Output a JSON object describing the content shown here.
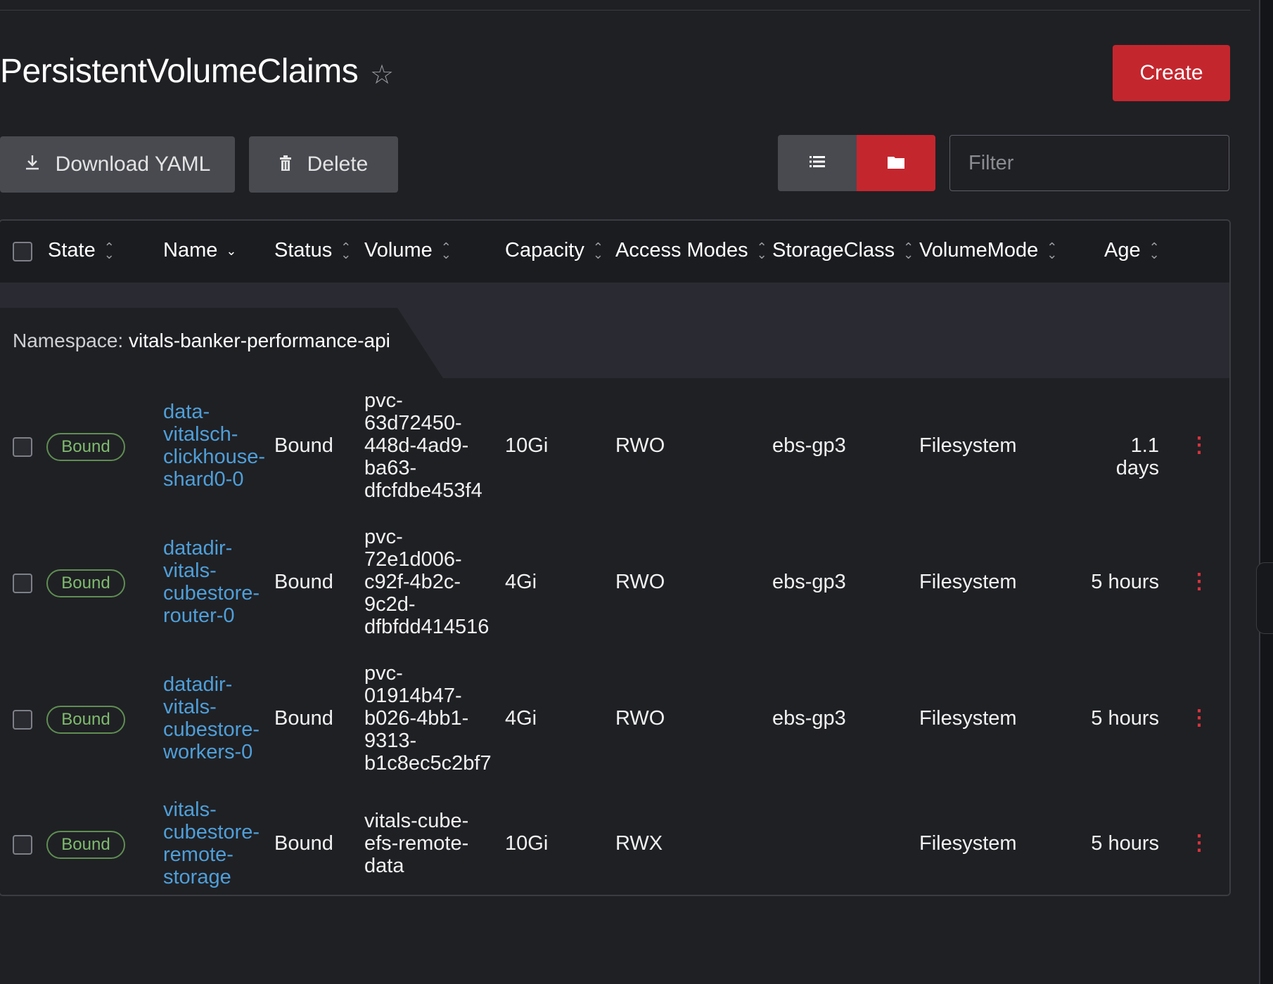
{
  "page": {
    "title": "PersistentVolumeClaims",
    "create_label": "Create",
    "download_label": "Download YAML",
    "delete_label": "Delete",
    "filter_placeholder": "Filter"
  },
  "colors": {
    "accent": "#c4262e",
    "link": "#4f9fd9",
    "badge": "#7fbb6e"
  },
  "table": {
    "columns": [
      "State",
      "Name",
      "Status",
      "Volume",
      "Capacity",
      "Access Modes",
      "StorageClass",
      "VolumeMode",
      "Age"
    ],
    "group": {
      "label": "Namespace:",
      "value": "vitals-banker-performance-api"
    },
    "rows": [
      {
        "state": "Bound",
        "name": [
          "data-",
          "vitalsch-",
          "clickhouse-",
          "shard0-0"
        ],
        "status": "Bound",
        "volume": [
          "pvc-",
          "63d72450-",
          "448d-4ad9-",
          "ba63-",
          "dfcfdbe453f4"
        ],
        "capacity": "10Gi",
        "access": "RWO",
        "storage_class": "ebs-gp3",
        "volume_mode": "Filesystem",
        "age": "1.1 days"
      },
      {
        "state": "Bound",
        "name": [
          "datadir-",
          "vitals-",
          "cubestore-",
          "router-0"
        ],
        "status": "Bound",
        "volume": [
          "pvc-",
          "72e1d006-",
          "c92f-4b2c-",
          "9c2d-",
          "dfbfdd414516"
        ],
        "capacity": "4Gi",
        "access": "RWO",
        "storage_class": "ebs-gp3",
        "volume_mode": "Filesystem",
        "age": "5 hours"
      },
      {
        "state": "Bound",
        "name": [
          "datadir-",
          "vitals-",
          "cubestore-",
          "workers-0"
        ],
        "status": "Bound",
        "volume": [
          "pvc-",
          "01914b47-",
          "b026-4bb1-",
          "9313-",
          "b1c8ec5c2bf7"
        ],
        "capacity": "4Gi",
        "access": "RWO",
        "storage_class": "ebs-gp3",
        "volume_mode": "Filesystem",
        "age": "5 hours"
      },
      {
        "state": "Bound",
        "name": [
          "vitals-",
          "cubestore-",
          "remote-",
          "storage"
        ],
        "status": "Bound",
        "volume": [
          "vitals-cube-",
          "efs-remote-",
          "data"
        ],
        "capacity": "10Gi",
        "access": "RWX",
        "storage_class": "",
        "volume_mode": "Filesystem",
        "age": "5 hours"
      }
    ]
  }
}
